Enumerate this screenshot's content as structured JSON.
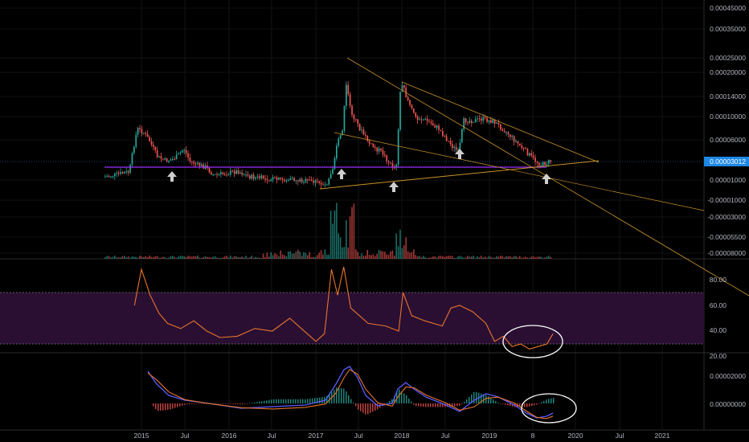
{
  "theme": {
    "background": "#000000",
    "axis_text": "#b2b5be",
    "grid": "#1a1a1a",
    "candle_up": "#26a69a",
    "candle_down": "#ef5350",
    "trendline": "#c8922a",
    "support": "#9b30ff",
    "rsi_line": "#e8742a",
    "rsi_band": "#2a0f33",
    "macd_line": "#5b5bff",
    "signal_line": "#e8742a",
    "arrow": "#cfcfcf",
    "circle": "#ffffff"
  },
  "chart_data": [
    {
      "type": "candlestick",
      "pane": "price",
      "y_tick_labels": [
        "0.00045000",
        "0.00035000",
        "0.00025000",
        "0.00020000",
        "0.00014000",
        "0.00010000",
        "0.00006000",
        "0.00001000",
        "-0.00001000",
        "-0.00003000",
        "-0.00005500",
        "-0.00008000"
      ],
      "last_price_label": "0.00003012",
      "last_price_color": "#1e88e5",
      "x_tick_labels": [
        "2015",
        "Jul",
        "2016",
        "Jul",
        "2017",
        "Jul",
        "2018",
        "Jul",
        "2019",
        "8",
        "2020",
        "Jul",
        "2021"
      ],
      "annotations": [
        "descending triangle trendlines",
        "horizontal support line",
        "up arrows marking bounces"
      ]
    },
    {
      "type": "line",
      "pane": "rsi",
      "name": "",
      "y_tick_labels": [
        "80.00",
        "60.00",
        "40.00",
        "20.00"
      ],
      "ylim": [
        20,
        95
      ],
      "band": [
        30,
        70
      ],
      "x_years": [
        2014.92,
        2015.0,
        2015.05,
        2015.1,
        2015.2,
        2015.3,
        2015.45,
        2015.6,
        2015.75,
        2015.9,
        2016.1,
        2016.3,
        2016.5,
        2016.7,
        2016.9,
        2017.0,
        2017.1,
        2017.18,
        2017.25,
        2017.32,
        2017.4,
        2017.5,
        2017.6,
        2017.8,
        2017.95,
        2018.0,
        2018.1,
        2018.25,
        2018.45,
        2018.55,
        2018.65,
        2018.8,
        2018.95,
        2019.05,
        2019.15,
        2019.25,
        2019.35,
        2019.45,
        2019.55,
        2019.65,
        2019.72
      ],
      "values": [
        60,
        88,
        78,
        68,
        54,
        46,
        42,
        48,
        40,
        35,
        36,
        42,
        40,
        50,
        38,
        32,
        38,
        88,
        68,
        90,
        58,
        52,
        46,
        44,
        40,
        70,
        52,
        48,
        44,
        58,
        60,
        55,
        46,
        32,
        36,
        28,
        30,
        26,
        28,
        30,
        38
      ]
    },
    {
      "type": "macd",
      "pane": "macd",
      "y_tick_labels": [
        "0.00002000",
        "0.00000000"
      ],
      "annotations": [
        "oval highlighting bullish crossover"
      ]
    }
  ]
}
